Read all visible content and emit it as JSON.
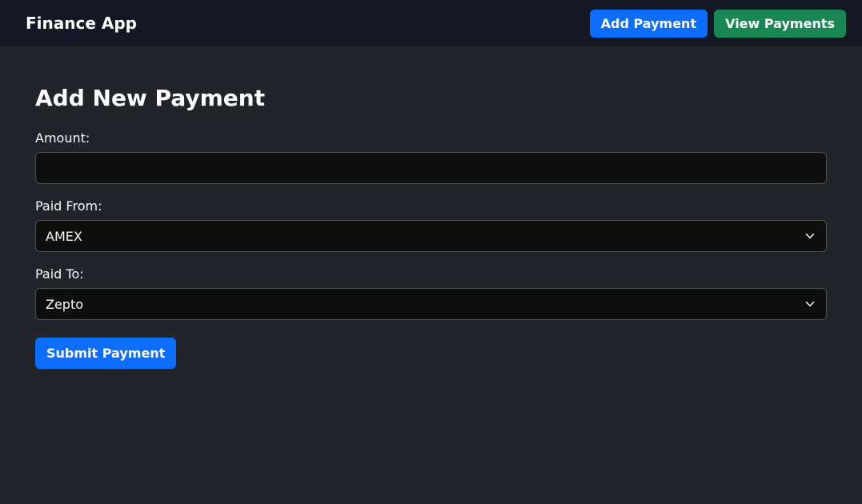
{
  "navbar": {
    "brand": "Finance App",
    "add_payment_label": "Add Payment",
    "view_payments_label": "View Payments"
  },
  "page": {
    "title": "Add New Payment"
  },
  "form": {
    "amount": {
      "label": "Amount:",
      "value": ""
    },
    "paid_from": {
      "label": "Paid From:",
      "selected": "AMEX"
    },
    "paid_to": {
      "label": "Paid To:",
      "selected": "Zepto"
    },
    "submit_label": "Submit Payment"
  }
}
